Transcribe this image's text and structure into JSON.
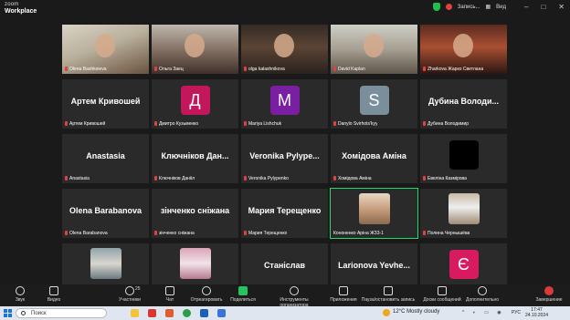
{
  "window": {
    "logo_line1": "zoom",
    "logo_line2": "Workplace",
    "recording_label": "Запись...",
    "view_label": "Вид"
  },
  "tiles": [
    {
      "kind": "video",
      "variant": "v1",
      "name": "Olena Bashkeieva",
      "muted": true
    },
    {
      "kind": "video",
      "variant": "v2",
      "name": "Ольга Заец",
      "muted": true
    },
    {
      "kind": "video",
      "variant": "v3",
      "name": "olga kalashnikova",
      "muted": true
    },
    {
      "kind": "video",
      "variant": "v4",
      "name": "David Kaplan",
      "muted": true
    },
    {
      "kind": "video",
      "variant": "v5",
      "name": "Zharkova Жарко Светлана",
      "muted": true
    },
    {
      "kind": "text",
      "big": "Артем Кривошей",
      "name": "Артем Кривошей",
      "muted": true
    },
    {
      "kind": "avatar",
      "letter": "Д",
      "color": "#c2185b",
      "name": "Дмитро Кузьменко",
      "muted": true
    },
    {
      "kind": "avatar",
      "letter": "M",
      "color": "#7b1fa2",
      "name": "Mariya Lishchuk",
      "muted": true
    },
    {
      "kind": "avatar",
      "letter": "S",
      "color": "#7a8e9c",
      "name": "Danylo Svirhots'kyy",
      "muted": true
    },
    {
      "kind": "text",
      "big": "Дубина Володи...",
      "name": "Дубина Володимир",
      "muted": true
    },
    {
      "kind": "text",
      "big": "Anastasia",
      "name": "Anastasia",
      "muted": true
    },
    {
      "kind": "text",
      "big": "Ключніков Дан...",
      "name": "Ключніков Данііл",
      "muted": true
    },
    {
      "kind": "text",
      "big": "Veronika Pylype...",
      "name": "Veronika Pylypenko",
      "muted": true
    },
    {
      "kind": "text",
      "big": "Хомідова Аміна",
      "name": "Хомідова Аміна",
      "muted": true
    },
    {
      "kind": "avatar",
      "letter": "",
      "color": "#000000",
      "name": "Евеліна Казмірова",
      "muted": true
    },
    {
      "kind": "text",
      "big": "Olena Barabanova",
      "name": "Olena Barabanova",
      "muted": true
    },
    {
      "kind": "text",
      "big": "зінченко сніжана",
      "name": "зінченко сніжана",
      "muted": true
    },
    {
      "kind": "text",
      "big": "Мария Терещенко",
      "name": "Мария Терещенко",
      "muted": true
    },
    {
      "kind": "photo",
      "photo": "p-girl",
      "name": "Кононенко Аріна ЖЗ3-1",
      "muted": false,
      "active": true
    },
    {
      "kind": "photo",
      "photo": "p-cat",
      "name": "Полина Чернышёва",
      "muted": true
    },
    {
      "kind": "photo",
      "photo": "p-kitten",
      "name": "Sofia Fedonyuk",
      "muted": true
    },
    {
      "kind": "photo",
      "photo": "p-flower",
      "name": "Милана Бунгаш",
      "muted": true
    },
    {
      "kind": "text",
      "big": "Станіслав",
      "name": "Станіслав",
      "muted": true
    },
    {
      "kind": "text",
      "big": "Larionova Yevhe...",
      "name": "Larionova Yevhenia",
      "muted": true
    },
    {
      "kind": "avatar",
      "letter": "Є",
      "color": "#d81b60",
      "name": "Єлизавета Пащенко",
      "muted": true
    }
  ],
  "toolbar": {
    "audio": "Звук",
    "video": "Видео",
    "participants": "Участники",
    "participants_count": "25",
    "chat": "Чат",
    "react": "Отреагировать",
    "share": "Поделиться",
    "host_tools": "Инструменты организатора",
    "apps": "Приложения",
    "record": "Пауза/остановить запись",
    "whiteboards": "Доски сообщений",
    "more": "Дополнительно",
    "end": "Завершение"
  },
  "taskbar": {
    "search_placeholder": "Поиск",
    "weather": "12°C  Mostly cloudy",
    "lang": "РУС",
    "time": "17:47",
    "date": "24.10.2024"
  }
}
